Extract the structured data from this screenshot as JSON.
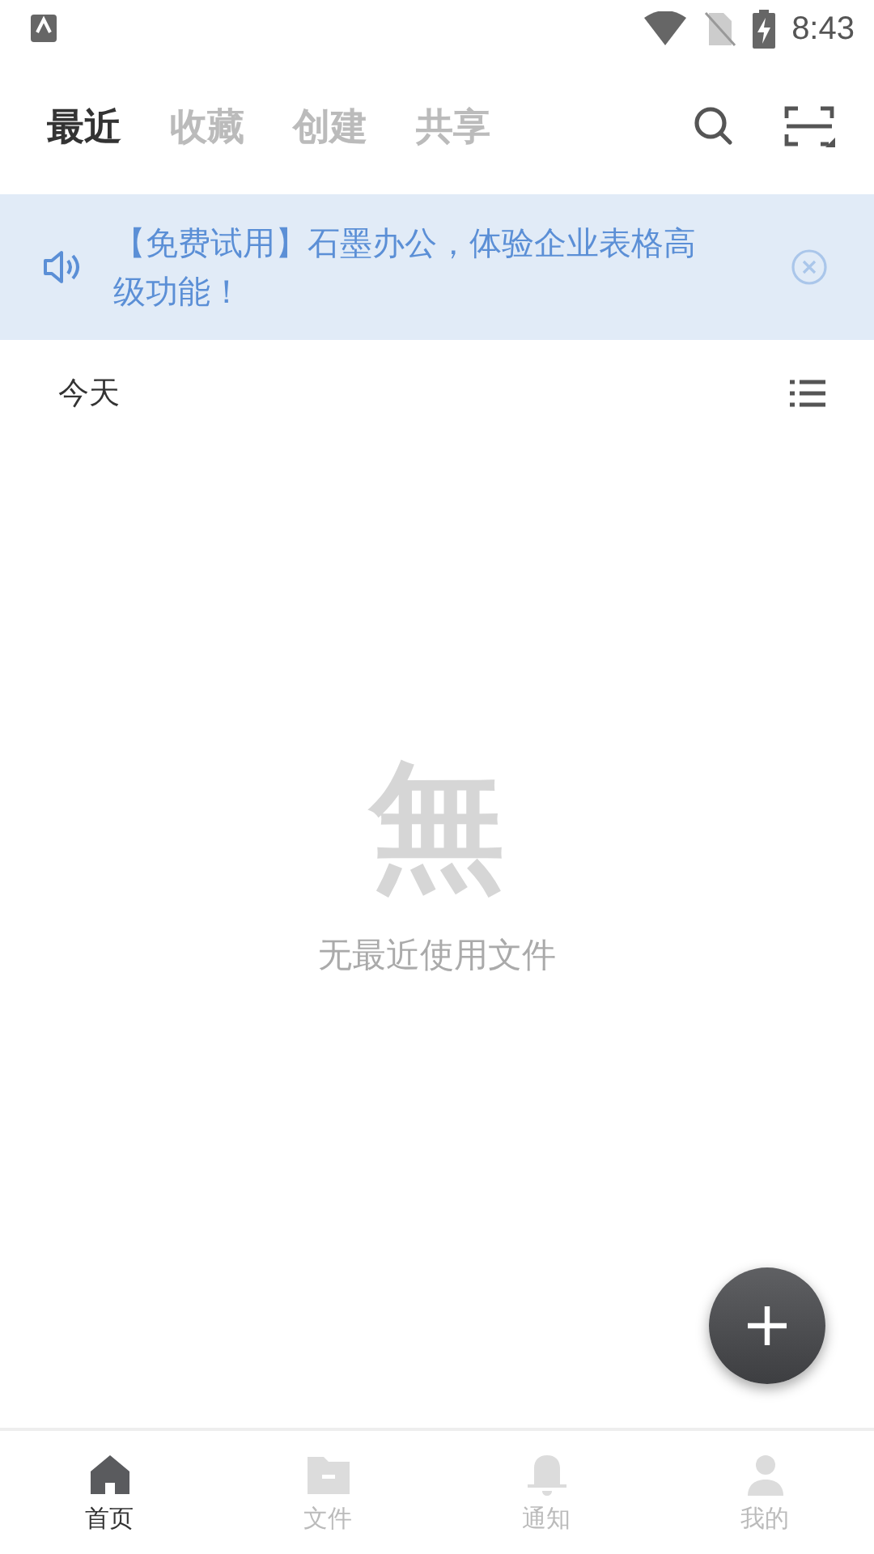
{
  "status_bar": {
    "time": "8:43"
  },
  "tabs": [
    {
      "label": "最近",
      "selected": true
    },
    {
      "label": "收藏",
      "selected": false
    },
    {
      "label": "创建",
      "selected": false
    },
    {
      "label": "共享",
      "selected": false
    }
  ],
  "banner": {
    "text": "【免费试用】石墨办公，体验企业表格高级功能！"
  },
  "section": {
    "title": "今天"
  },
  "empty_state": {
    "glyph": "無",
    "message": "无最近使用文件"
  },
  "bottom_nav": [
    {
      "kind": "home",
      "label": "首页",
      "selected": true
    },
    {
      "kind": "files",
      "label": "文件",
      "selected": false
    },
    {
      "kind": "notifications",
      "label": "通知",
      "selected": false
    },
    {
      "kind": "profile",
      "label": "我的",
      "selected": false
    }
  ]
}
